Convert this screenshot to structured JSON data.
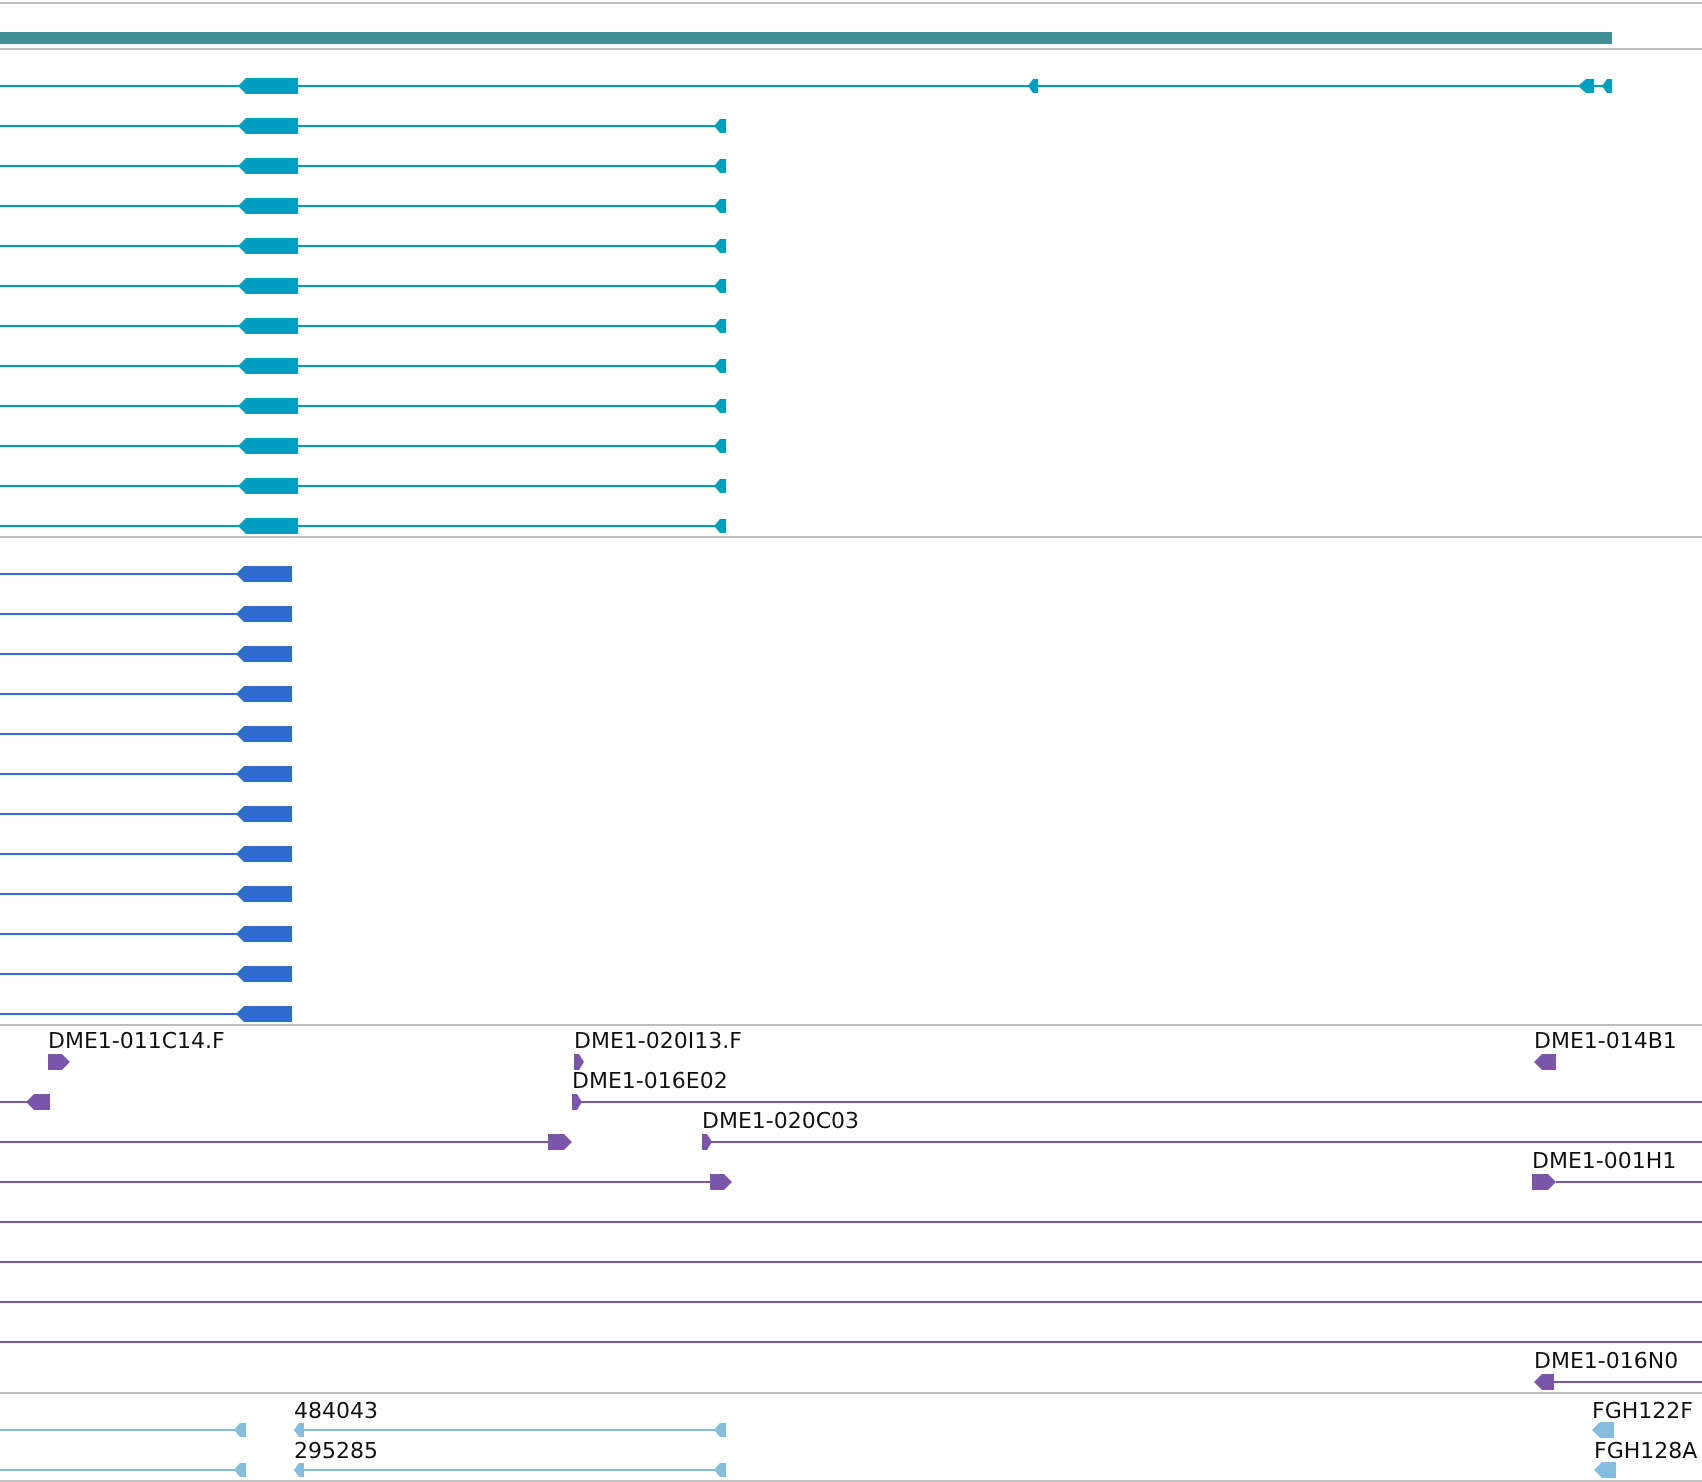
{
  "tracks": [
    {
      "kind": "coverage",
      "color": "#418f93"
    },
    {
      "kind": "transcripts",
      "color": "#009fc2"
    },
    {
      "kind": "genes",
      "color": "#2e6dcc"
    },
    {
      "kind": "clones",
      "color": "#7a55aa",
      "labels": [
        "DME1-011C14.F",
        "DME1-020I13.F",
        "DME1-014B1",
        "DME1-016E02",
        "DME1-020C03",
        "DME1-001H1",
        "DME1-016N0"
      ]
    },
    {
      "kind": "ests",
      "color": "#84bde0",
      "labels": [
        "484043",
        "FGH122F",
        "295285",
        "FGH128A"
      ]
    }
  ]
}
